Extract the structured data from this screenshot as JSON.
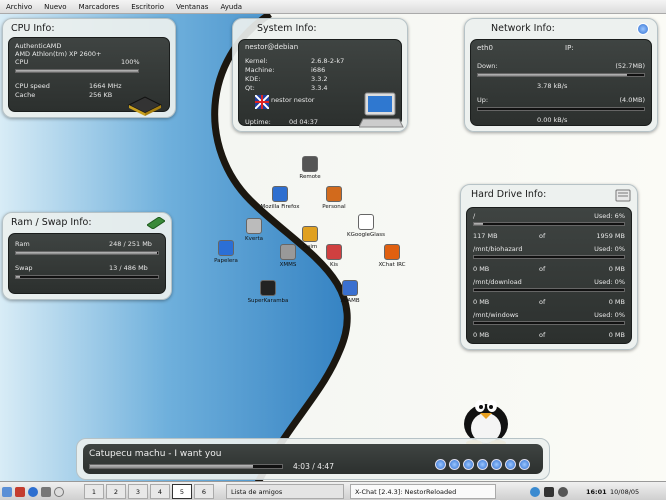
{
  "menubar": {
    "items": [
      "Archivo",
      "Nuevo",
      "Marcadores",
      "Escritorio",
      "Ventanas",
      "Ayuda"
    ]
  },
  "cpu": {
    "title": "CPU Info:",
    "vendor": "AuthenticAMD",
    "model": "AMD Athlon(tm) XP 2600+",
    "usage_label": "CPU",
    "usage_value": "100%",
    "usage": 1.0,
    "speed_label": "CPU speed",
    "speed_value": "1664 MHz",
    "cache_label": "Cache",
    "cache_value": "256 KB"
  },
  "system": {
    "title": "System Info:",
    "user_host": "nestor@debian",
    "rows": [
      {
        "k": "Kernel:",
        "v": "2.6.8-2-k7"
      },
      {
        "k": "Machine:",
        "v": "i686"
      },
      {
        "k": "KDE:",
        "v": "3.3.2"
      },
      {
        "k": "Qt:",
        "v": "3.3.4"
      }
    ],
    "login": "nestor nestor",
    "uptime_label": "Uptime:",
    "uptime_value": "0d 04:37"
  },
  "network": {
    "title": "Network Info:",
    "iface": "eth0",
    "ip_label": "IP:",
    "down_label": "Down:",
    "down_total": "(52.7MB)",
    "down_rate": "3.78 kB/s",
    "down": 0.9,
    "up_label": "Up:",
    "up_total": "(4.0MB)",
    "up_rate": "0.00 kB/s",
    "up": 0.0
  },
  "ram": {
    "title": "Ram / Swap Info:",
    "ram_label": "Ram",
    "ram_value": "248 / 251 Mb",
    "ram": 0.99,
    "swap_label": "Swap",
    "swap_value": "13 / 486 Mb",
    "swap": 0.03
  },
  "disk": {
    "title": "Hard Drive Info:",
    "of_label": "of",
    "drives": [
      {
        "mount": "/",
        "used": "Used: 6%",
        "a": "117 MB",
        "b": "1959 MB",
        "pct": 0.06
      },
      {
        "mount": "/mnt/biohazard",
        "used": "Used: 0%",
        "a": "0 MB",
        "b": "0 MB",
        "pct": 0
      },
      {
        "mount": "/mnt/download",
        "used": "Used: 0%",
        "a": "0 MB",
        "b": "0 MB",
        "pct": 0
      },
      {
        "mount": "/mnt/windows",
        "used": "Used: 0%",
        "a": "0 MB",
        "b": "0 MB",
        "pct": 0
      }
    ]
  },
  "desktop_icons": [
    "Remote",
    "Mozilla Firefox",
    "Personal",
    "Kverta",
    "Gaim",
    "KGoogleGlass",
    "Papelera",
    "XMMS",
    "Kis",
    "XChat IRC",
    "SuperKaramba",
    "XLAMB"
  ],
  "player": {
    "track": "Catupecu machu - I want you",
    "time": "4:03 / 4:47",
    "progress": 0.85
  },
  "taskbar": {
    "desktops": [
      "1",
      "2",
      "3",
      "4",
      "5",
      "6"
    ],
    "tasks": [
      "Lista de amigos",
      "X-Chat [2.4.3]: NestorReloaded"
    ],
    "time": "16:01",
    "date": "10/08/05"
  },
  "colors": {
    "panel": "#ecf0ee",
    "panel_body": "#353a38",
    "accent": "#2e6fd0"
  }
}
